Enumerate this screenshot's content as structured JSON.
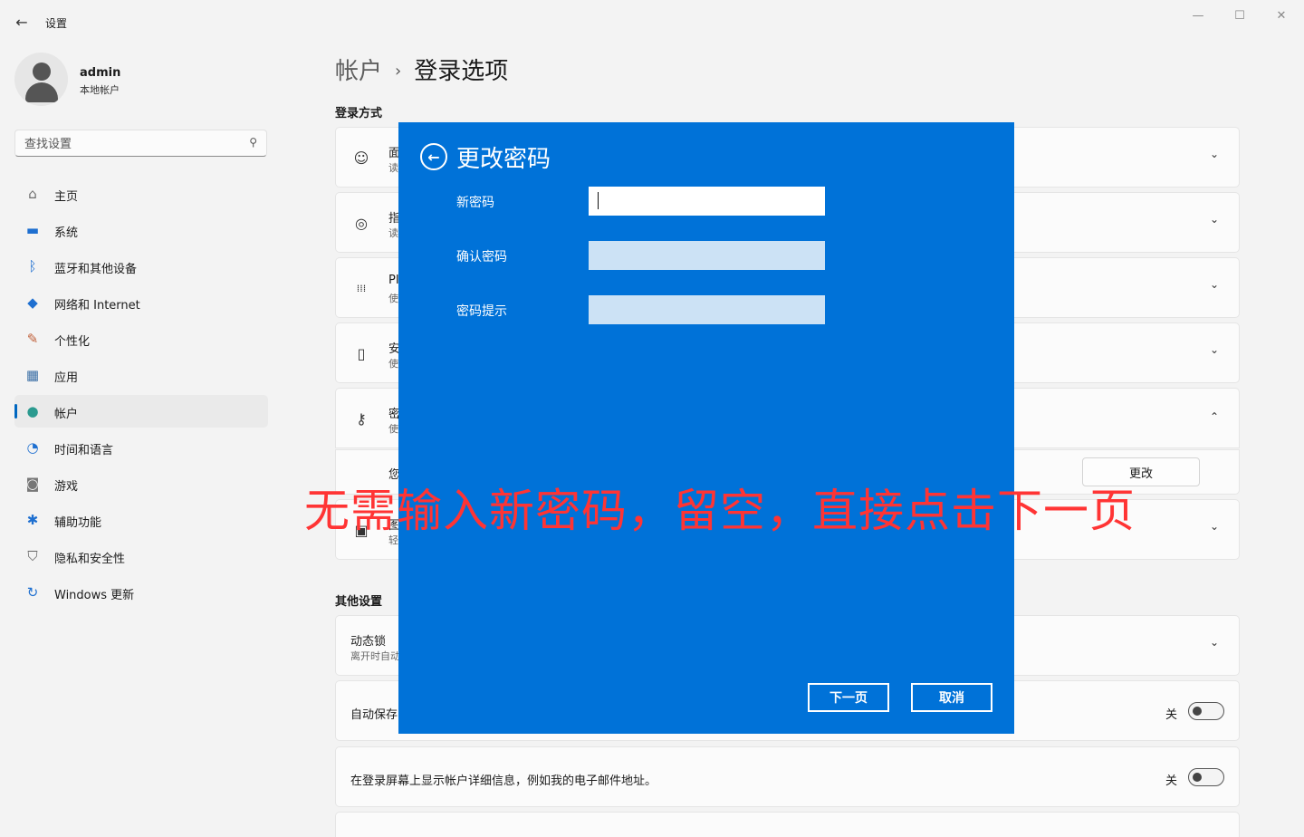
{
  "window": {
    "title": "设置",
    "back_glyph": "←",
    "minimize_glyph": "—",
    "maximize_glyph": "☐",
    "close_glyph": "✕"
  },
  "profile": {
    "name": "admin",
    "account_type": "本地帐户"
  },
  "search": {
    "placeholder": "查找设置",
    "icon": "search-icon"
  },
  "sidebar": {
    "items": [
      {
        "label": "主页",
        "icon": "home-icon",
        "glyph": "⌂",
        "color": "#6b6b6b"
      },
      {
        "label": "系统",
        "icon": "system-icon",
        "glyph": "▬",
        "color": "#1e6fd0"
      },
      {
        "label": "蓝牙和其他设备",
        "icon": "bluetooth-icon",
        "glyph": "ᛒ",
        "color": "#1e6fd0"
      },
      {
        "label": "网络和 Internet",
        "icon": "wifi-icon",
        "glyph": "◆",
        "color": "#1e6fd0"
      },
      {
        "label": "个性化",
        "icon": "brush-icon",
        "glyph": "✎",
        "color": "#c0603a"
      },
      {
        "label": "应用",
        "icon": "apps-icon",
        "glyph": "▦",
        "color": "#3a6ea5"
      },
      {
        "label": "帐户",
        "icon": "account-icon",
        "glyph": "●",
        "color": "#2b9a8f",
        "active": true
      },
      {
        "label": "时间和语言",
        "icon": "clock-globe-icon",
        "glyph": "◔",
        "color": "#1e6fd0"
      },
      {
        "label": "游戏",
        "icon": "gamepad-icon",
        "glyph": "◙",
        "color": "#777"
      },
      {
        "label": "辅助功能",
        "icon": "accessibility-icon",
        "glyph": "✱",
        "color": "#1e6fd0"
      },
      {
        "label": "隐私和安全性",
        "icon": "shield-icon",
        "glyph": "⛉",
        "color": "#666"
      },
      {
        "label": "Windows 更新",
        "icon": "update-icon",
        "glyph": "↻",
        "color": "#1e6fd0"
      }
    ]
  },
  "breadcrumb": {
    "parent": "帐户",
    "separator": "›",
    "current": "登录选项"
  },
  "signin_section": {
    "title": "登录方式",
    "cards": [
      {
        "title": "面",
        "sub": "读",
        "icon": "face-icon",
        "glyph": "☺"
      },
      {
        "title": "指",
        "sub": "读",
        "icon": "fingerprint-icon",
        "glyph": "◎"
      },
      {
        "title": "PI",
        "sub": "使",
        "icon": "pin-keypad-icon",
        "glyph": "⁞⁞⁞"
      },
      {
        "title": "安",
        "sub": "使",
        "icon": "security-key-icon",
        "glyph": "▯"
      },
      {
        "title": "密",
        "sub": "使",
        "icon": "key-icon",
        "glyph": "⚷",
        "expanded": true,
        "detail": "您",
        "action_label": "更改"
      },
      {
        "title": "图",
        "sub": "轻",
        "icon": "picture-icon",
        "glyph": "▣"
      }
    ]
  },
  "other_section": {
    "title": "其他设置",
    "cards": [
      {
        "title": "动态锁",
        "sub": "离开时自动"
      },
      {
        "title": "自动保存",
        "toggle_label": "关"
      },
      {
        "title": "在登录屏幕上显示帐户详细信息，例如我的电子邮件地址。",
        "toggle_label": "关"
      }
    ]
  },
  "chevron_down": "⌄",
  "chevron_up": "⌃",
  "dialog": {
    "back_glyph": "←",
    "title": "更改密码",
    "fields": {
      "new_password": {
        "label": "新密码",
        "value": ""
      },
      "confirm_password": {
        "label": "确认密码",
        "value": ""
      },
      "password_hint": {
        "label": "密码提示",
        "value": ""
      }
    },
    "next_label": "下一页",
    "cancel_label": "取消",
    "background": "#0072d8"
  },
  "annotation": {
    "text": "无需输入新密码，留空，直接点击下一页",
    "color": "#ff3434"
  }
}
